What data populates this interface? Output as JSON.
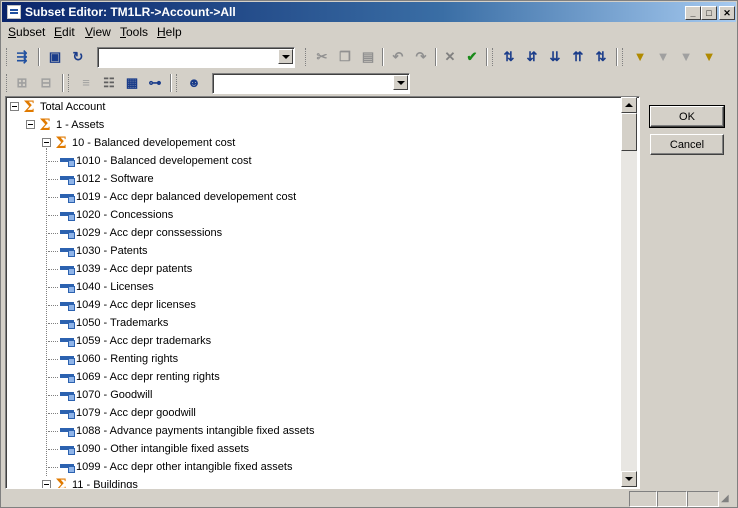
{
  "window": {
    "title": "Subset Editor:  TM1LR->Account->All",
    "controls": [
      "minimize",
      "maximize",
      "close"
    ]
  },
  "menu": [
    "Subset",
    "Edit",
    "View",
    "Tools",
    "Help"
  ],
  "toolbar1": {
    "subset_combo_value": "",
    "icons": [
      "subset-all-icon",
      "save-icon",
      "reset-icon",
      "cut-icon",
      "copy-icon",
      "paste-icon",
      "undo-icon",
      "redo-icon",
      "delete-icon",
      "keep-icon",
      "sort-asc-icon",
      "sort-desc-icon",
      "sort-hierarchy-icon",
      "sort-index-asc-icon",
      "sort-index-desc-icon",
      "filter-level-icon",
      "filter-attribute-icon",
      "filter-expression-icon",
      "filter-wildcard-icon"
    ]
  },
  "toolbar2": {
    "alias_combo_value": "",
    "icons": [
      "expand-icon",
      "collapse-icon",
      "drill-down-icon",
      "roll-up-icon",
      "properties-icon",
      "hierarchy-icon",
      "user-icon"
    ]
  },
  "tree": [
    {
      "label": "Total Account",
      "type": "consolidated",
      "level": 0
    },
    {
      "label": "1 - Assets",
      "type": "consolidated",
      "level": 1
    },
    {
      "label": "10 - Balanced developement cost",
      "type": "consolidated",
      "level": 2
    },
    {
      "label": "1010 - Balanced developement cost",
      "type": "leaf",
      "level": 3
    },
    {
      "label": "1012 - Software",
      "type": "leaf",
      "level": 3
    },
    {
      "label": "1019 - Acc depr balanced developement cost",
      "type": "leaf",
      "level": 3
    },
    {
      "label": "1020 - Concessions",
      "type": "leaf",
      "level": 3
    },
    {
      "label": "1029 - Acc depr conssessions",
      "type": "leaf",
      "level": 3
    },
    {
      "label": "1030 - Patents",
      "type": "leaf",
      "level": 3
    },
    {
      "label": "1039 - Acc depr patents",
      "type": "leaf",
      "level": 3
    },
    {
      "label": "1040 - Licenses",
      "type": "leaf",
      "level": 3
    },
    {
      "label": "1049 - Acc depr licenses",
      "type": "leaf",
      "level": 3
    },
    {
      "label": "1050 - Trademarks",
      "type": "leaf",
      "level": 3
    },
    {
      "label": "1059 - Acc depr trademarks",
      "type": "leaf",
      "level": 3
    },
    {
      "label": "1060 - Renting rights",
      "type": "leaf",
      "level": 3
    },
    {
      "label": "1069 - Acc depr renting rights",
      "type": "leaf",
      "level": 3
    },
    {
      "label": "1070 - Goodwill",
      "type": "leaf",
      "level": 3
    },
    {
      "label": "1079 - Acc depr goodwill",
      "type": "leaf",
      "level": 3
    },
    {
      "label": "1088 - Advance payments intangible fixed assets",
      "type": "leaf",
      "level": 3
    },
    {
      "label": "1090 - Other intangible fixed assets",
      "type": "leaf",
      "level": 3
    },
    {
      "label": "1099 - Acc depr other intangible fixed assets",
      "type": "leaf",
      "level": 3
    },
    {
      "label": "11 - Buildings",
      "type": "consolidated",
      "level": 2
    }
  ],
  "buttons": {
    "ok": "OK",
    "cancel": "Cancel"
  }
}
